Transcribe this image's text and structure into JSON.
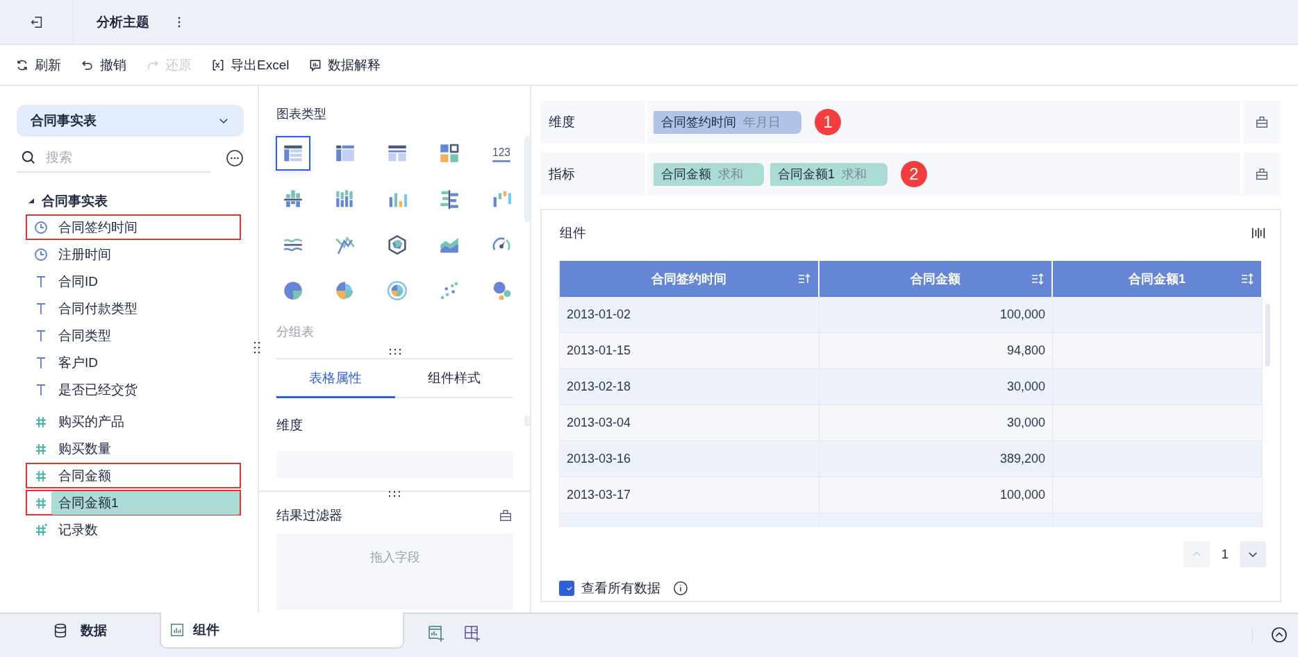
{
  "header": {
    "title": "分析主题"
  },
  "toolbar": [
    {
      "label": "刷新",
      "kind": "refresh",
      "disabled": false
    },
    {
      "label": "撤销",
      "kind": "undo",
      "disabled": false
    },
    {
      "label": "还原",
      "kind": "redo",
      "disabled": true
    },
    {
      "label": "导出Excel",
      "kind": "excel",
      "disabled": false
    },
    {
      "label": "数据解释",
      "kind": "explain",
      "disabled": false
    }
  ],
  "data_panel": {
    "dataset": "合同事实表",
    "search": {
      "placeholder": "搜索"
    },
    "tree": {
      "label": "合同事实表",
      "expanded": true,
      "children": [
        {
          "label": "合同签约时间",
          "kind": "date",
          "outlined": true,
          "dragging": false
        },
        {
          "label": "注册时间",
          "kind": "date",
          "outlined": false,
          "dragging": false
        },
        {
          "label": "合同ID",
          "kind": "text",
          "outlined": false,
          "dragging": false
        },
        {
          "label": "合同付款类型",
          "kind": "text",
          "outlined": false,
          "dragging": false
        },
        {
          "label": "合同类型",
          "kind": "text",
          "outlined": false,
          "dragging": false
        },
        {
          "label": "客户ID",
          "kind": "text",
          "outlined": false,
          "dragging": false
        },
        {
          "label": "是否已经交货",
          "kind": "text",
          "outlined": false,
          "dragging": false
        },
        {
          "label": "购买的产品",
          "kind": "number",
          "outlined": false,
          "dragging": false
        },
        {
          "label": "购买数量",
          "kind": "number",
          "outlined": false,
          "dragging": false
        },
        {
          "label": "合同金额",
          "kind": "number",
          "outlined": true,
          "dragging": false
        },
        {
          "label": "合同金额1",
          "kind": "number",
          "outlined": true,
          "dragging": true
        },
        {
          "label": "记录数",
          "kind": "count",
          "outlined": false,
          "dragging": false
        }
      ]
    }
  },
  "chart_panel": {
    "title": "图表类型",
    "chart_types": [
      {
        "selected": true
      },
      {
        "selected": false
      },
      {
        "selected": false
      },
      {
        "selected": false
      },
      {
        "selected": false,
        "text": "123"
      },
      {
        "selected": false
      },
      {
        "selected": false
      },
      {
        "selected": false
      },
      {
        "selected": false
      },
      {
        "selected": false
      },
      {
        "selected": false
      },
      {
        "selected": false
      },
      {
        "selected": false
      },
      {
        "selected": false
      },
      {
        "selected": false
      },
      {
        "selected": false
      },
      {
        "selected": false
      },
      {
        "selected": false
      },
      {
        "selected": false
      },
      {
        "selected": false
      }
    ],
    "chart_name": "分组表",
    "tabs": [
      {
        "label": "表格属性",
        "selected": true
      },
      {
        "label": "组件样式",
        "selected": false
      }
    ],
    "section": "维度",
    "filter": {
      "title": "结果过滤器",
      "placeholder": "拖入字段"
    }
  },
  "shelves": [
    {
      "label": "维度",
      "kind": "dimension",
      "badge": "1",
      "pills": [
        {
          "name": "合同签约时间",
          "agg": "年月日"
        }
      ]
    },
    {
      "label": "指标",
      "kind": "measure",
      "badge": "2",
      "pills": [
        {
          "name": "合同金额",
          "agg": "求和"
        },
        {
          "name": "合同金额1",
          "agg": "求和"
        }
      ]
    }
  ],
  "component": {
    "title": "组件",
    "table": {
      "columns": [
        {
          "label": "合同签约时间",
          "sorted": true
        },
        {
          "label": "合同金额",
          "sorted": false
        },
        {
          "label": "合同金额1",
          "sorted": false
        }
      ],
      "rows": [
        [
          "2013-01-02",
          "100,000",
          ""
        ],
        [
          "2013-01-15",
          "94,800",
          ""
        ],
        [
          "2013-02-18",
          "30,000",
          ""
        ],
        [
          "2013-03-04",
          "30,000",
          ""
        ],
        [
          "2013-03-16",
          "389,200",
          ""
        ],
        [
          "2013-03-17",
          "100,000",
          ""
        ]
      ]
    },
    "page": "1",
    "show_all": {
      "label": "查看所有数据",
      "checked": true
    }
  },
  "bottom_tabs": [
    {
      "label": "数据",
      "kind": "data",
      "selected": false
    },
    {
      "label": "组件",
      "kind": "component",
      "selected": true
    }
  ]
}
